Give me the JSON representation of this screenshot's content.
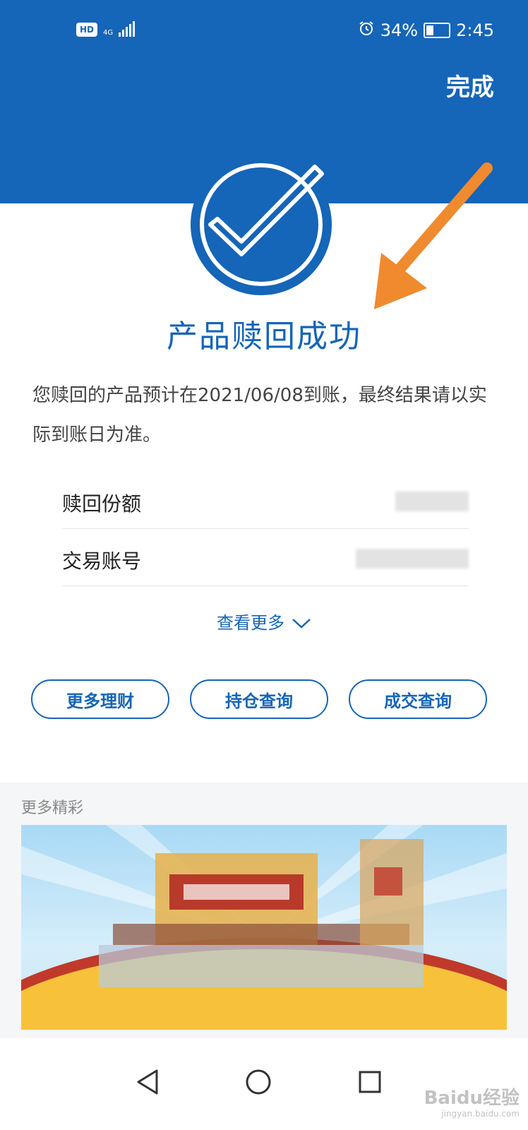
{
  "status_bar": {
    "hd": "HD",
    "network": "4G",
    "battery_percent": "34%",
    "time": "2:45"
  },
  "header": {
    "done_label": "完成"
  },
  "result": {
    "title": "产品赎回成功",
    "description": "您赎回的产品预计在2021/06/08到账，最终结果请以实际到账日为准。"
  },
  "details": {
    "rows": [
      {
        "label": "赎回份额"
      },
      {
        "label": "交易账号"
      }
    ],
    "see_more": "查看更多"
  },
  "actions": [
    {
      "label": "更多理财"
    },
    {
      "label": "持仓查询"
    },
    {
      "label": "成交查询"
    }
  ],
  "more_section": {
    "title": "更多精彩"
  },
  "watermark": {
    "text": "Baidu经验",
    "sub": "jingyan.baidu.com"
  },
  "colors": {
    "brand_blue": "#1565b8",
    "arrow_orange": "#f08a2e"
  },
  "icons": [
    "check-circle-icon",
    "back-icon",
    "home-icon",
    "recents-icon",
    "chevron-down-icon",
    "alarm-icon",
    "battery-icon",
    "signal-icon"
  ]
}
